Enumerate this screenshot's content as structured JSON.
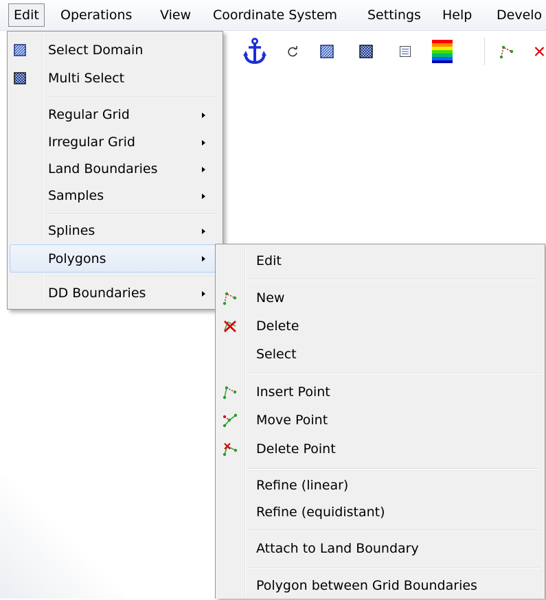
{
  "menubar": {
    "items": [
      "Edit",
      "Operations",
      "View",
      "Coordinate System",
      "Settings",
      "Help",
      "Develo"
    ]
  },
  "toolbar": {
    "icons": [
      "tool-icon-partial",
      "anchor-icon",
      "refresh-icon",
      "select-domain-icon",
      "multi-select-icon",
      "list-icon",
      "colormap-icon",
      "polygon-new-icon",
      "polygon-delete-icon"
    ]
  },
  "edit_menu": {
    "items": [
      {
        "label": "Select Domain",
        "icon": "select-domain-icon"
      },
      {
        "label": "Multi Select",
        "icon": "multi-select-icon"
      },
      {
        "label": "Regular Grid",
        "submenu": true
      },
      {
        "label": "Irregular Grid",
        "submenu": true
      },
      {
        "label": "Land Boundaries",
        "submenu": true
      },
      {
        "label": "Samples",
        "submenu": true
      },
      {
        "label": "Splines",
        "submenu": true
      },
      {
        "label": "Polygons",
        "submenu": true,
        "highlighted": true
      },
      {
        "label": "DD Boundaries",
        "submenu": true
      }
    ]
  },
  "polygons_menu": {
    "items": [
      {
        "label": "Edit"
      },
      {
        "label": "New",
        "icon": "polygon-new-icon"
      },
      {
        "label": "Delete",
        "icon": "polygon-delete-icon"
      },
      {
        "label": "Select"
      },
      {
        "label": "Insert Point",
        "icon": "insert-point-icon"
      },
      {
        "label": "Move Point",
        "icon": "move-point-icon"
      },
      {
        "label": "Delete Point",
        "icon": "delete-point-icon"
      },
      {
        "label": "Refine (linear)"
      },
      {
        "label": "Refine (equidistant)"
      },
      {
        "label": "Attach to Land Boundary"
      },
      {
        "label": "Polygon between Grid Boundaries"
      }
    ]
  },
  "colors": {
    "menu_bg": "#f0f0f0",
    "highlight_border": "#aecff7",
    "anchor_blue": "#1a2fd6",
    "polygon_green": "#2a9a2a",
    "polygon_red": "#d40000"
  }
}
